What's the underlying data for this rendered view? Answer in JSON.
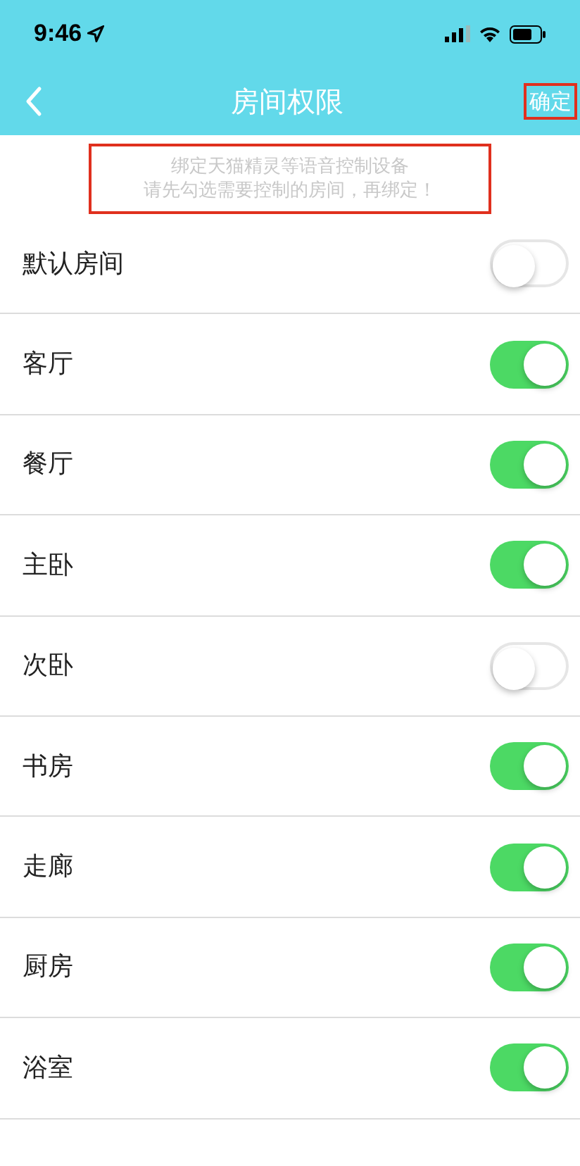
{
  "status_bar": {
    "time": "9:46"
  },
  "nav": {
    "title": "房间权限",
    "confirm": "确定"
  },
  "notice": [
    "绑定天猫精灵等语音控制设备",
    "请先勾选需要控制的房间，再绑定！"
  ],
  "rooms": [
    {
      "name": "默认房间",
      "on": false
    },
    {
      "name": "客厅",
      "on": true
    },
    {
      "name": "餐厅",
      "on": true
    },
    {
      "name": "主卧",
      "on": true
    },
    {
      "name": "次卧",
      "on": false
    },
    {
      "name": "书房",
      "on": true
    },
    {
      "name": "走廊",
      "on": true
    },
    {
      "name": "厨房",
      "on": true
    },
    {
      "name": "浴室",
      "on": true
    }
  ]
}
